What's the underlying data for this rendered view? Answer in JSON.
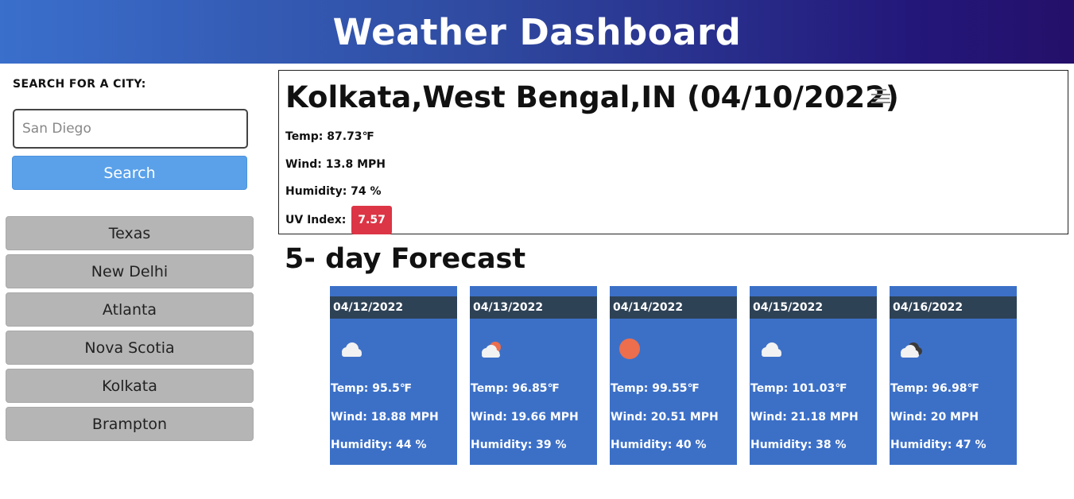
{
  "header": {
    "title": "Weather Dashboard"
  },
  "search": {
    "label": "SEARCH FOR A CITY:",
    "placeholder": "San Diego",
    "button_label": "Search"
  },
  "history": [
    {
      "label": "Texas"
    },
    {
      "label": "New Delhi"
    },
    {
      "label": "Atlanta"
    },
    {
      "label": "Nova Scotia"
    },
    {
      "label": "Kolkata"
    },
    {
      "label": "Brampton"
    }
  ],
  "current": {
    "title": "Kolkata,West Bengal,IN (04/10/2022)",
    "icon": "haze-icon",
    "temp": "Temp: 87.73℉",
    "wind": "Wind: 13.8 MPH",
    "humidity": "Humidity: 74 %",
    "uv_label": "UV Index:",
    "uv_value": "7.57",
    "uv_color": "#dc3545"
  },
  "forecast": {
    "title": "5- day Forecast",
    "days": [
      {
        "date": "04/12/2022",
        "icon": "cloud-icon",
        "temp": "Temp: 95.5℉",
        "wind": "Wind: 18.88 MPH",
        "humidity": "Humidity: 44 %"
      },
      {
        "date": "04/13/2022",
        "icon": "partly-cloudy-icon",
        "temp": "Temp: 96.85℉",
        "wind": "Wind: 19.66 MPH",
        "humidity": "Humidity: 39 %"
      },
      {
        "date": "04/14/2022",
        "icon": "sun-icon",
        "temp": "Temp: 99.55℉",
        "wind": "Wind: 20.51 MPH",
        "humidity": "Humidity: 40 %"
      },
      {
        "date": "04/15/2022",
        "icon": "cloud-icon",
        "temp": "Temp: 101.03℉",
        "wind": "Wind: 21.18 MPH",
        "humidity": "Humidity: 38 %"
      },
      {
        "date": "04/16/2022",
        "icon": "broken-clouds-icon",
        "temp": "Temp: 96.98℉",
        "wind": "Wind: 20 MPH",
        "humidity": "Humidity: 47 %"
      }
    ]
  },
  "colors": {
    "header_gradient_start": "#3a6fcc",
    "header_gradient_end": "#24106a",
    "search_button": "#5aa1ea",
    "history_item": "#b5b5b5",
    "card_background": "#3c70c7",
    "card_date_bar": "#2e4256",
    "sun": "#ec6e4c"
  }
}
